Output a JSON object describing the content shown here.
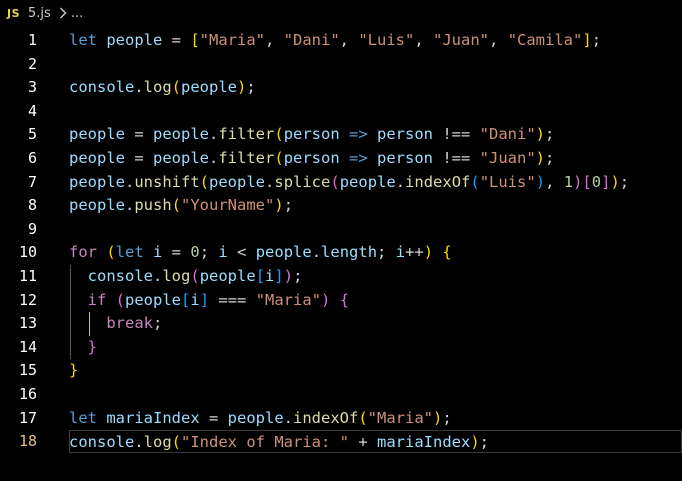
{
  "breadcrumb": {
    "language_badge": "JS",
    "file_name": "5.js",
    "trailing": "..."
  },
  "editor": {
    "current_line": 18,
    "lines": [
      {
        "n": "1",
        "tokens": [
          [
            "kw",
            "let "
          ],
          [
            "var",
            "people "
          ],
          [
            "op",
            "= "
          ],
          [
            "p1",
            "["
          ],
          [
            "str",
            "\"Maria\""
          ],
          [
            "op",
            ", "
          ],
          [
            "str",
            "\"Dani\""
          ],
          [
            "op",
            ", "
          ],
          [
            "str",
            "\"Luis\""
          ],
          [
            "op",
            ", "
          ],
          [
            "str",
            "\"Juan\""
          ],
          [
            "op",
            ", "
          ],
          [
            "str",
            "\"Camila\""
          ],
          [
            "p1",
            "]"
          ],
          [
            "op",
            ";"
          ]
        ]
      },
      {
        "n": "2",
        "tokens": []
      },
      {
        "n": "3",
        "tokens": [
          [
            "var",
            "console"
          ],
          [
            "op",
            "."
          ],
          [
            "fn",
            "log"
          ],
          [
            "p1",
            "("
          ],
          [
            "var",
            "people"
          ],
          [
            "p1",
            ")"
          ],
          [
            "op",
            ";"
          ]
        ]
      },
      {
        "n": "4",
        "tokens": []
      },
      {
        "n": "5",
        "tokens": [
          [
            "var",
            "people "
          ],
          [
            "op",
            "= "
          ],
          [
            "var",
            "people"
          ],
          [
            "op",
            "."
          ],
          [
            "fn",
            "filter"
          ],
          [
            "p1",
            "("
          ],
          [
            "var",
            "person "
          ],
          [
            "kw",
            "=> "
          ],
          [
            "var",
            "person "
          ],
          [
            "op",
            "!== "
          ],
          [
            "str",
            "\"Dani\""
          ],
          [
            "p1",
            ")"
          ],
          [
            "op",
            ";"
          ]
        ]
      },
      {
        "n": "6",
        "tokens": [
          [
            "var",
            "people "
          ],
          [
            "op",
            "= "
          ],
          [
            "var",
            "people"
          ],
          [
            "op",
            "."
          ],
          [
            "fn",
            "filter"
          ],
          [
            "p1",
            "("
          ],
          [
            "var",
            "person "
          ],
          [
            "kw",
            "=> "
          ],
          [
            "var",
            "person "
          ],
          [
            "op",
            "!== "
          ],
          [
            "str",
            "\"Juan\""
          ],
          [
            "p1",
            ")"
          ],
          [
            "op",
            ";"
          ]
        ]
      },
      {
        "n": "7",
        "tokens": [
          [
            "var",
            "people"
          ],
          [
            "op",
            "."
          ],
          [
            "fn",
            "unshift"
          ],
          [
            "p1",
            "("
          ],
          [
            "var",
            "people"
          ],
          [
            "op",
            "."
          ],
          [
            "fn",
            "splice"
          ],
          [
            "p2",
            "("
          ],
          [
            "var",
            "people"
          ],
          [
            "op",
            "."
          ],
          [
            "fn",
            "indexOf"
          ],
          [
            "p3",
            "("
          ],
          [
            "str",
            "\"Luis\""
          ],
          [
            "p3",
            ")"
          ],
          [
            "op",
            ", "
          ],
          [
            "num",
            "1"
          ],
          [
            "p2",
            ")"
          ],
          [
            "p2",
            "["
          ],
          [
            "num",
            "0"
          ],
          [
            "p2",
            "]"
          ],
          [
            "p1",
            ")"
          ],
          [
            "op",
            ";"
          ]
        ]
      },
      {
        "n": "8",
        "tokens": [
          [
            "var",
            "people"
          ],
          [
            "op",
            "."
          ],
          [
            "fn",
            "push"
          ],
          [
            "p1",
            "("
          ],
          [
            "str",
            "\"YourName\""
          ],
          [
            "p1",
            ")"
          ],
          [
            "op",
            ";"
          ]
        ]
      },
      {
        "n": "9",
        "tokens": []
      },
      {
        "n": "10",
        "tokens": [
          [
            "ctl",
            "for "
          ],
          [
            "p1",
            "("
          ],
          [
            "kw",
            "let "
          ],
          [
            "var",
            "i "
          ],
          [
            "op",
            "= "
          ],
          [
            "num",
            "0"
          ],
          [
            "op",
            "; "
          ],
          [
            "var",
            "i "
          ],
          [
            "op",
            "< "
          ],
          [
            "var",
            "people"
          ],
          [
            "op",
            "."
          ],
          [
            "var",
            "length"
          ],
          [
            "op",
            "; "
          ],
          [
            "var",
            "i"
          ],
          [
            "op",
            "++"
          ],
          [
            "p1",
            ")"
          ],
          [
            "op",
            " "
          ],
          [
            "p1",
            "{"
          ]
        ]
      },
      {
        "n": "11",
        "tokens": [
          [
            "var",
            "  console"
          ],
          [
            "op",
            "."
          ],
          [
            "fn",
            "log"
          ],
          [
            "p2",
            "("
          ],
          [
            "var",
            "people"
          ],
          [
            "p3",
            "["
          ],
          [
            "var",
            "i"
          ],
          [
            "p3",
            "]"
          ],
          [
            "p2",
            ")"
          ],
          [
            "op",
            ";"
          ]
        ]
      },
      {
        "n": "12",
        "tokens": [
          [
            "ctl",
            "  if "
          ],
          [
            "p2",
            "("
          ],
          [
            "var",
            "people"
          ],
          [
            "p3",
            "["
          ],
          [
            "var",
            "i"
          ],
          [
            "p3",
            "]"
          ],
          [
            "op",
            " === "
          ],
          [
            "str",
            "\"Maria\""
          ],
          [
            "p2",
            ")"
          ],
          [
            "op",
            " "
          ],
          [
            "p2",
            "{"
          ]
        ]
      },
      {
        "n": "13",
        "tokens": [
          [
            "ctl",
            "    break"
          ],
          [
            "op",
            ";"
          ]
        ]
      },
      {
        "n": "14",
        "tokens": [
          [
            "p2",
            "  }"
          ]
        ]
      },
      {
        "n": "15",
        "tokens": [
          [
            "p1",
            "}"
          ]
        ]
      },
      {
        "n": "16",
        "tokens": []
      },
      {
        "n": "17",
        "tokens": [
          [
            "kw",
            "let "
          ],
          [
            "var",
            "mariaIndex "
          ],
          [
            "op",
            "= "
          ],
          [
            "var",
            "people"
          ],
          [
            "op",
            "."
          ],
          [
            "fn",
            "indexOf"
          ],
          [
            "p1",
            "("
          ],
          [
            "str",
            "\"Maria\""
          ],
          [
            "p1",
            ")"
          ],
          [
            "op",
            ";"
          ]
        ]
      },
      {
        "n": "18",
        "tokens": [
          [
            "var",
            "console"
          ],
          [
            "op",
            "."
          ],
          [
            "fn",
            "log"
          ],
          [
            "p1",
            "("
          ],
          [
            "str",
            "\"Index of Maria: \""
          ],
          [
            "op",
            " + "
          ],
          [
            "var",
            "mariaIndex"
          ],
          [
            "p1",
            ")"
          ],
          [
            "op",
            ";"
          ]
        ]
      }
    ]
  }
}
